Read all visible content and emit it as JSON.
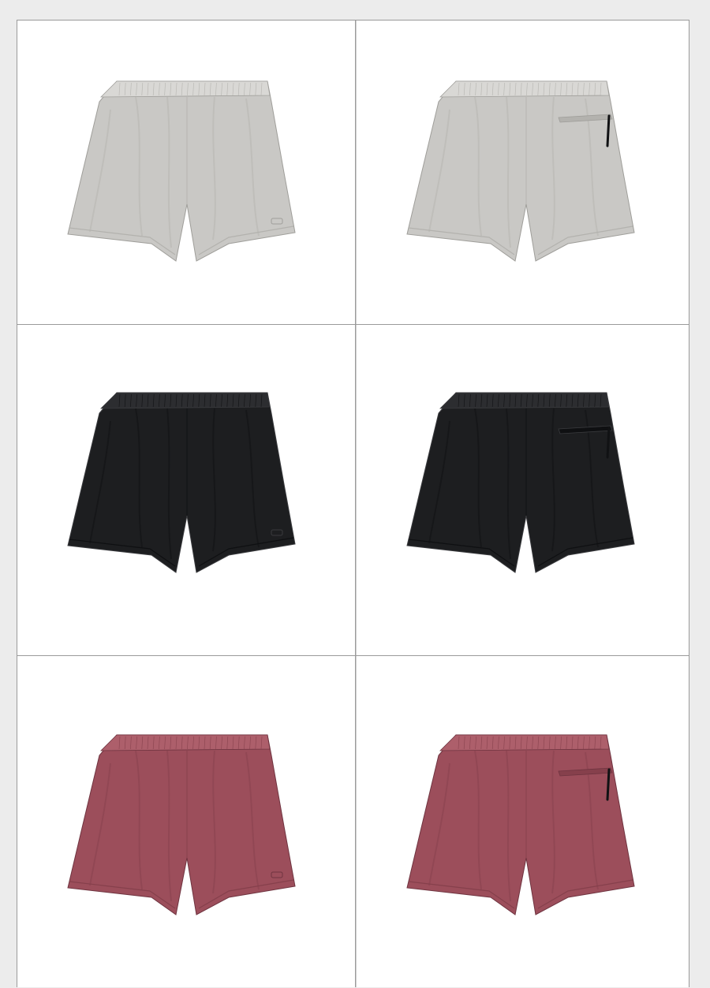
{
  "grid": {
    "rows": [
      {
        "color_name": "light-gray",
        "fabric": "#c9c8c5",
        "shade": "#b3b2ae",
        "highlight": "#d9d8d5",
        "trim": "#9f9e9a"
      },
      {
        "color_name": "black",
        "fabric": "#1d1e20",
        "shade": "#0f1012",
        "highlight": "#2c2d30",
        "trim": "#3a3b3e"
      },
      {
        "color_name": "dusty-rose",
        "fabric": "#9c4e5b",
        "shade": "#86404c",
        "highlight": "#ad5f6b",
        "trim": "#6f3440"
      }
    ],
    "views": [
      "front",
      "back"
    ]
  }
}
